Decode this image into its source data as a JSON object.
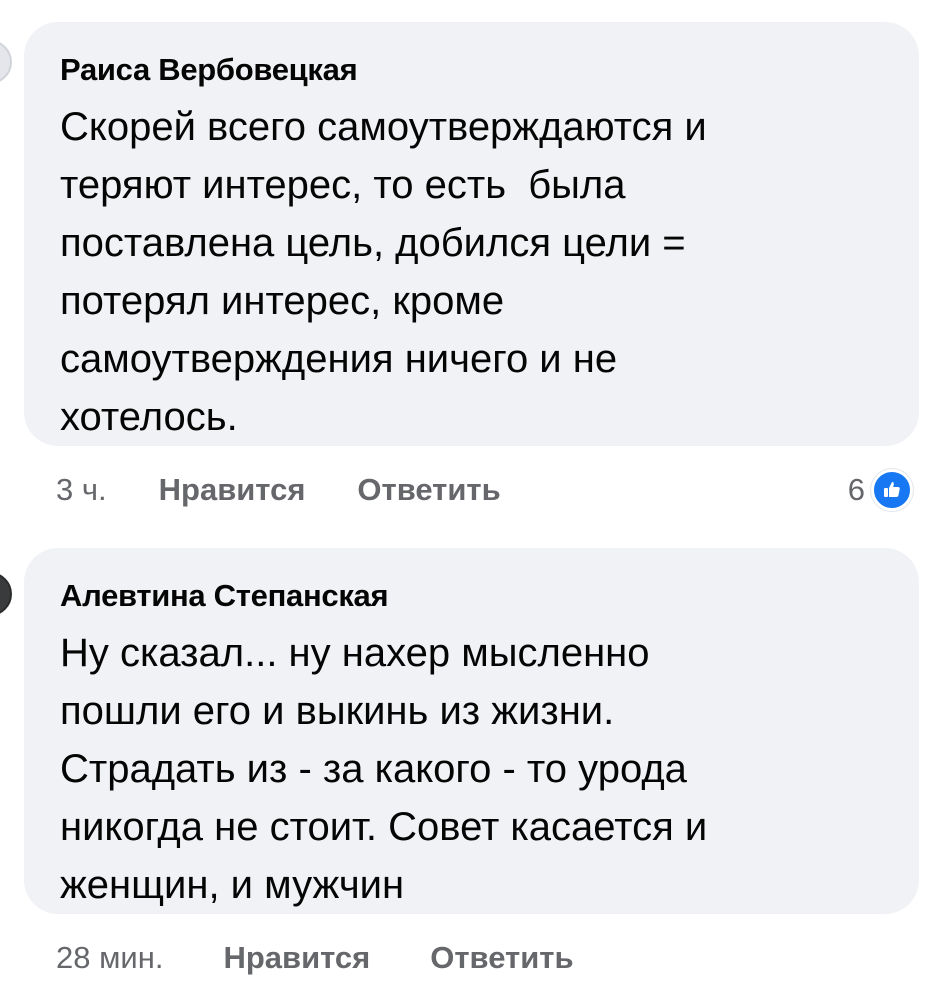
{
  "comments": [
    {
      "author": "Раиса Вербовецкая",
      "text": "Скорей всего самоутверждаются и\nтеряют интерес, то есть  была\nпоставлена цель, добился цели =\nпотерял интерес, кроме\nсамоутверждения ничего и не\nхотелось.",
      "time": "3 ч.",
      "like_label": "Нравится",
      "reply_label": "Ответить",
      "reaction_count": "6",
      "reaction_icon": "like-thumb-icon"
    },
    {
      "author": "Алевтина Степанская",
      "text": "Ну сказал... ну нахер мысленно\nпошли его и выкинь из жизни.\nСтрадать из - за какого - то урода\nникогда не стоит. Совет касается и\nженщин, и мужчин",
      "time": "28 мин.",
      "like_label": "Нравится",
      "reply_label": "Ответить"
    }
  ],
  "colors": {
    "bubble_bg": "#f0f2f5",
    "text": "#050505",
    "secondary_text": "#65676b",
    "like_blue": "#1877f2"
  }
}
